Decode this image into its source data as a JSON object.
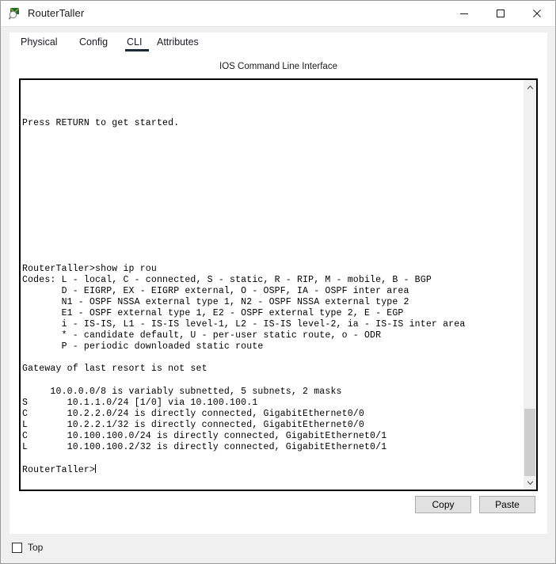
{
  "window": {
    "title": "RouterTaller",
    "icon": "packet-tracer-device-icon",
    "controls": {
      "minimize": "—",
      "maximize": "□",
      "close": "✕"
    }
  },
  "tabs": [
    {
      "label": "Physical",
      "selected": false
    },
    {
      "label": "Config",
      "selected": false
    },
    {
      "label": "CLI",
      "selected": true
    },
    {
      "label": "Attributes",
      "selected": false
    }
  ],
  "cli": {
    "caption": "IOS Command Line Interface",
    "prompt": "RouterTaller>",
    "output": "\n\n\nPress RETURN to get started.\n\n\n\n\n\n\n\n\n\n\n\n\nRouterTaller>show ip rou\nCodes: L - local, C - connected, S - static, R - RIP, M - mobile, B - BGP\n       D - EIGRP, EX - EIGRP external, O - OSPF, IA - OSPF inter area\n       N1 - OSPF NSSA external type 1, N2 - OSPF NSSA external type 2\n       E1 - OSPF external type 1, E2 - OSPF external type 2, E - EGP\n       i - IS-IS, L1 - IS-IS level-1, L2 - IS-IS level-2, ia - IS-IS inter area\n       * - candidate default, U - per-user static route, o - ODR\n       P - periodic downloaded static route\n\nGateway of last resort is not set\n\n     10.0.0.0/8 is variably subnetted, 5 subnets, 2 masks\nS       10.1.1.0/24 [1/0] via 10.100.100.1\nC       10.2.2.0/24 is directly connected, GigabitEthernet0/0\nL       10.2.2.1/32 is directly connected, GigabitEthernet0/0\nC       10.100.100.0/24 is directly connected, GigabitEthernet0/1\nL       10.100.100.2/32 is directly connected, GigabitEthernet0/1\n\n"
  },
  "scrollbar": {
    "up_arrow": "▲",
    "down_arrow": "▼"
  },
  "buttons": {
    "copy": "Copy",
    "paste": "Paste"
  },
  "footer": {
    "top_checkbox_label": "Top",
    "top_checked": false
  },
  "colors": {
    "panel_bg": "#ffffff",
    "window_bg": "#f0f0f0",
    "tab_underline": "#1b2838",
    "terminal_text": "#000000",
    "scroll_thumb": "#cdcdcd",
    "button_face": "#e1e1e1"
  }
}
